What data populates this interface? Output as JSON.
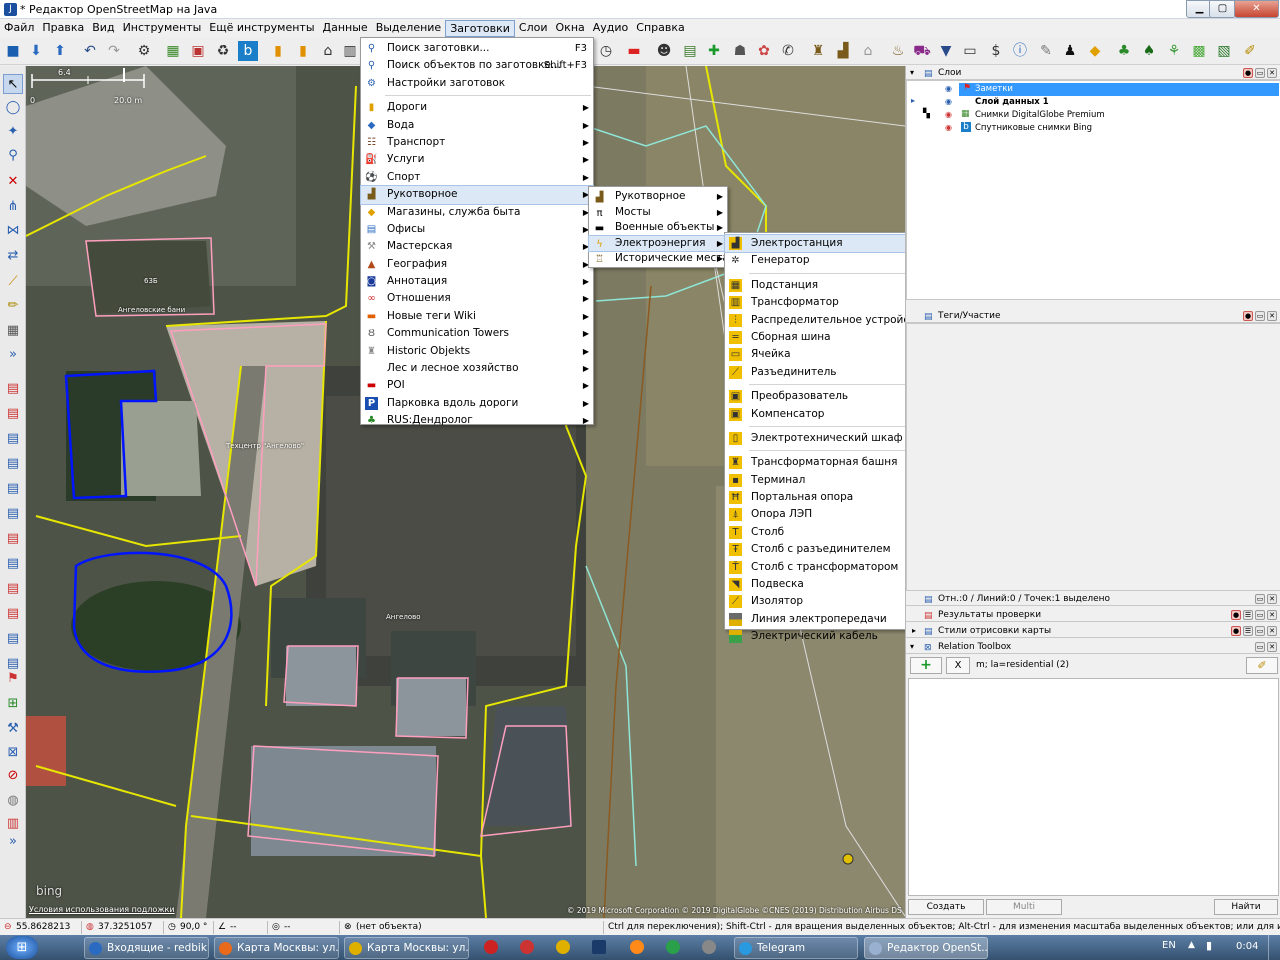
{
  "window": {
    "title": "* Редактор OpenStreetMap на Java",
    "min": "▁",
    "max": "▢",
    "close": "✕"
  },
  "menubar": [
    "Файл",
    "Правка",
    "Вид",
    "Инструменты",
    "Ещё инструменты",
    "Данные",
    "Выделение",
    "Заготовки",
    "Слои",
    "Окна",
    "Аудио",
    "Справка"
  ],
  "menu_presets": {
    "top": [
      {
        "label": "Поиск заготовки...",
        "shortcut": "F3"
      },
      {
        "label": "Поиск объектов по заготовке...",
        "shortcut": "Shift+F3"
      },
      {
        "label": "Настройки заготовок",
        "shortcut": ""
      }
    ],
    "items": [
      "Дороги",
      "Вода",
      "Транспорт",
      "Услуги",
      "Спорт",
      "Рукотворное",
      "Магазины, служба быта",
      "Офисы",
      "Мастерская",
      "География",
      "Аннотация",
      "Отношения",
      "Новые теги Wiki",
      "Communication Towers",
      "Historic Objekts",
      "Лес и лесное хозяйство",
      "POI",
      "Парковка вдоль дороги",
      "RUS:Дендролог"
    ]
  },
  "menu_manmade": [
    "Рукотворное",
    "Мосты",
    "Военные объекты",
    "Электроэнергия",
    "Исторические места"
  ],
  "menu_power": {
    "group1": [
      "Электростанция",
      "Генератор"
    ],
    "group2": [
      "Подстанция",
      "Трансформатор",
      "Распределительное устройство",
      "Сборная шина",
      "Ячейка",
      "Разъединитель"
    ],
    "group3": [
      "Преобразователь",
      "Компенсатор"
    ],
    "group4": [
      "Электротехнический шкаф"
    ],
    "group5": [
      "Трансформаторная башня",
      "Терминал",
      "Портальная опора",
      "Опора ЛЭП",
      "Столб",
      "Столб с разъединителем",
      "Столб с трансформатором",
      "Подвеска",
      "Изолятор",
      "Линия электропередачи",
      "Электрический кабель"
    ]
  },
  "map": {
    "scale_label": "20.0 m",
    "scale_zero": "0",
    "scale_mid": "6.4",
    "labels": {
      "house": "63Б",
      "bath": "Ангеловские бани",
      "tech": "Техцентр \"Ангелово\"",
      "substation": "Ангелово"
    },
    "bing": "bing",
    "terms": "Условия использования подложки",
    "attribution": "© 2019 Microsoft Corporation © 2019 DigitalGlobe ©CNES (2019) Distribution Airbus DS"
  },
  "panels": {
    "layers": {
      "title": "Слои",
      "items": [
        "Заметки",
        "Слой данных 1",
        "Снимки DigitalGlobe Premium",
        "Спутниковые снимки Bing"
      ]
    },
    "tags": {
      "title": "Теги/Участие"
    },
    "selection": {
      "title": "Отн.:0 / Линий:0 / Точек:1 выделено"
    },
    "validation": {
      "title": "Результаты проверки"
    },
    "styles": {
      "title": "Стили отрисовки карты"
    },
    "relation": {
      "title": "Relation Toolbox",
      "add": "+",
      "clear": "X",
      "query": "m; la=residential (2)"
    },
    "buttons": {
      "create": "Создать",
      "multi": "Multi",
      "find": "Найти"
    }
  },
  "statusbar": {
    "lat": "55.8628213",
    "lon": "37.3251057",
    "heading": "90,0 °",
    "angle": "--",
    "dist": "--",
    "object": "(нет объекта)",
    "hint": "Ctrl для переключения); Shift-Ctrl - для вращения выделенных объектов; Alt-Ctrl - для изменения масштаба выделенных объектов; или для изменения выделения"
  },
  "taskbar": {
    "items": [
      "Входящие - redbik...",
      "Карта Москвы: ул...",
      "Карта Москвы: ул...",
      "Telegram",
      "Редактор OpenSt..."
    ],
    "lang": "EN",
    "time": "0:04"
  },
  "colors": {
    "accent": "#3399ff",
    "way_yellow": "#ffff00",
    "selected_blue": "#0000ff"
  }
}
